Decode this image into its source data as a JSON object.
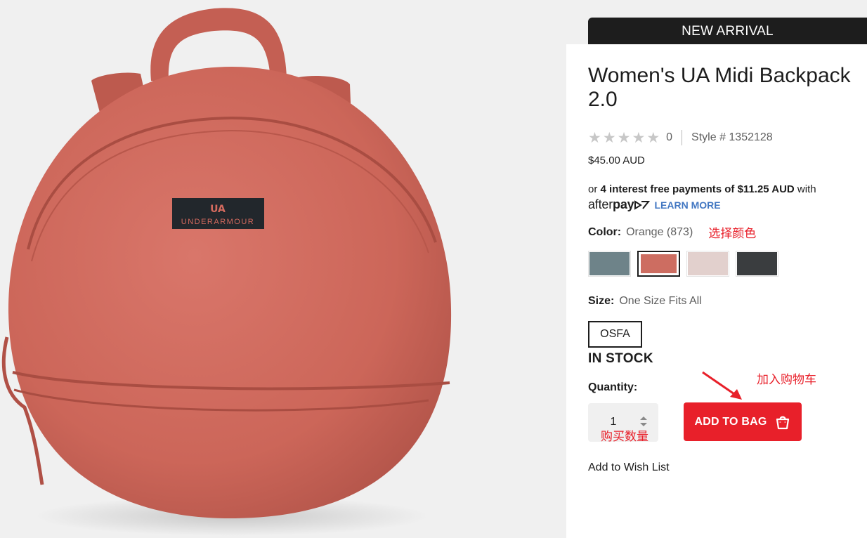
{
  "product": {
    "badge": "NEW ARRIVAL",
    "title": "Women's UA Midi Backpack 2.0",
    "rating_count": "0",
    "style": "Style # 1352128",
    "price": "$45.00 AUD",
    "rating_stars": 0,
    "brand_label": "UNDERARMOUR"
  },
  "afterpay": {
    "prefix": "or ",
    "bold_text": "4 interest free payments of $11.25 AUD",
    "suffix": " with",
    "logo_regular": "after",
    "logo_bold": "pay",
    "learn_more": "LEARN MORE"
  },
  "color": {
    "label": "Color:",
    "value": "Orange (873)",
    "swatches": [
      {
        "name": "grey-blue",
        "hex": "#6e8389",
        "selected": false
      },
      {
        "name": "orange",
        "hex": "#cd6d61",
        "selected": true
      },
      {
        "name": "light-pink",
        "hex": "#e2d0cd",
        "selected": false
      },
      {
        "name": "dark-grey",
        "hex": "#3a3d3f",
        "selected": false
      }
    ]
  },
  "size": {
    "label": "Size:",
    "value": "One Size Fits All",
    "option": "OSFA"
  },
  "stock": "IN STOCK",
  "quantity": {
    "label": "Quantity:",
    "value": "1"
  },
  "actions": {
    "add_to_bag": "ADD TO BAG",
    "wishlist": "Add to Wish List"
  },
  "annotations": {
    "select_color": "选择颜色",
    "add_to_cart": "加入购物车",
    "quantity": "购买数量"
  },
  "colors": {
    "accent_red": "#e8202a",
    "dark": "#1d1d1d",
    "link_blue": "#4277c2"
  }
}
